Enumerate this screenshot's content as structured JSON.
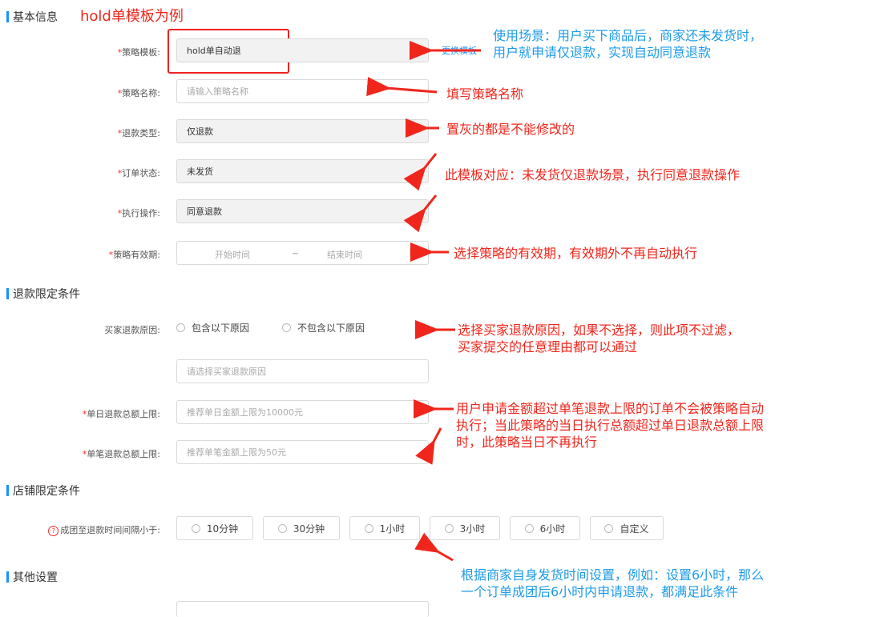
{
  "sections": {
    "basic": "基本信息",
    "basic_example": "hold单模板为例",
    "refund_conditions": "退款限定条件",
    "store_conditions": "店铺限定条件",
    "other": "其他设置"
  },
  "fields": {
    "template": {
      "required": "*",
      "label": "策略模板:",
      "value": "hold单自动退",
      "side_link": "更换模板"
    },
    "name": {
      "required": "*",
      "label": "策略名称:",
      "placeholder": "请输入策略名称"
    },
    "refund_type": {
      "required": "*",
      "label": "退款类型:",
      "value": "仅退款"
    },
    "order_status": {
      "required": "*",
      "label": "订单状态:",
      "value": "未发货"
    },
    "action": {
      "required": "*",
      "label": "执行操作:",
      "value": "同意退款"
    },
    "validity": {
      "required": "*",
      "label": "策略有效期:",
      "start": "开始时间",
      "sep": "~",
      "end": "结束时间"
    },
    "buyer_reason": {
      "label": "买家退款原因:",
      "options": [
        "包含以下原因",
        "不包含以下原因"
      ],
      "placeholder": "请选择买家退款原因"
    },
    "daily_limit": {
      "required": "*",
      "label": "单日退款总额上限:",
      "placeholder": "推荐单日金额上限为10000元"
    },
    "single_limit": {
      "required": "*",
      "label": "单笔退款总额上限:",
      "placeholder": "推荐单笔金额上限为50元"
    },
    "interval": {
      "icon": "?",
      "label": "成团至退款时间间隔小于:",
      "options": [
        "10分钟",
        "30分钟",
        "1小时",
        "3小时",
        "6小时",
        "自定义"
      ]
    }
  },
  "annotations": {
    "scene": [
      "使用场景：用户买下商品后，商家还未发货时，",
      "用户就申请仅退款，实现自动同意退款"
    ],
    "name": "填写策略名称",
    "grey": "置灰的都是不能修改的",
    "template_match": "此模板对应：未发货仅退款场景，执行同意退款操作",
    "validity": "选择策略的有效期，有效期外不再自动执行",
    "reason": [
      "选择买家退款原因，如果不选择，则此项不过滤，",
      "买家提交的任意理由都可以通过"
    ],
    "limits": [
      "用户申请金额超过单笔退款上限的订单不会被策略自动",
      "执行；当此策略的当日执行总额超过单日退款总额上限",
      "时，此策略当日不再执行"
    ],
    "interval": [
      "根据商家自身发货时间设置，例如：设置6小时，那么",
      "一个订单成团后6小时内申请退款，都满足此条件"
    ]
  },
  "colors": {
    "annotation_red": "#f0261c",
    "annotation_blue": "#1e9be8",
    "section_bar": "#1890ff",
    "required": "#ff2a2a"
  }
}
